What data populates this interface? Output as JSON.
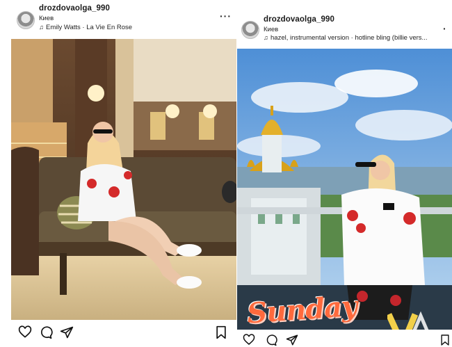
{
  "post_left": {
    "username": "drozdovaolga_990",
    "location": "Киев",
    "music": "Emily Watts · La Vie En Rose"
  },
  "post_right": {
    "username": "drozdovaolga_990",
    "location": "Киев",
    "music": "hazel, instrumental version · hotline bling (billie vers...",
    "overlay_text": "Sunday"
  },
  "icons": {
    "like": "heart-icon",
    "comment": "comment-icon",
    "share": "send-icon",
    "save": "bookmark-icon",
    "more": "more-icon",
    "mute": "speaker-muted-icon"
  },
  "colors": {
    "overlay_text": "#ff6a3d",
    "text": "#111111"
  }
}
